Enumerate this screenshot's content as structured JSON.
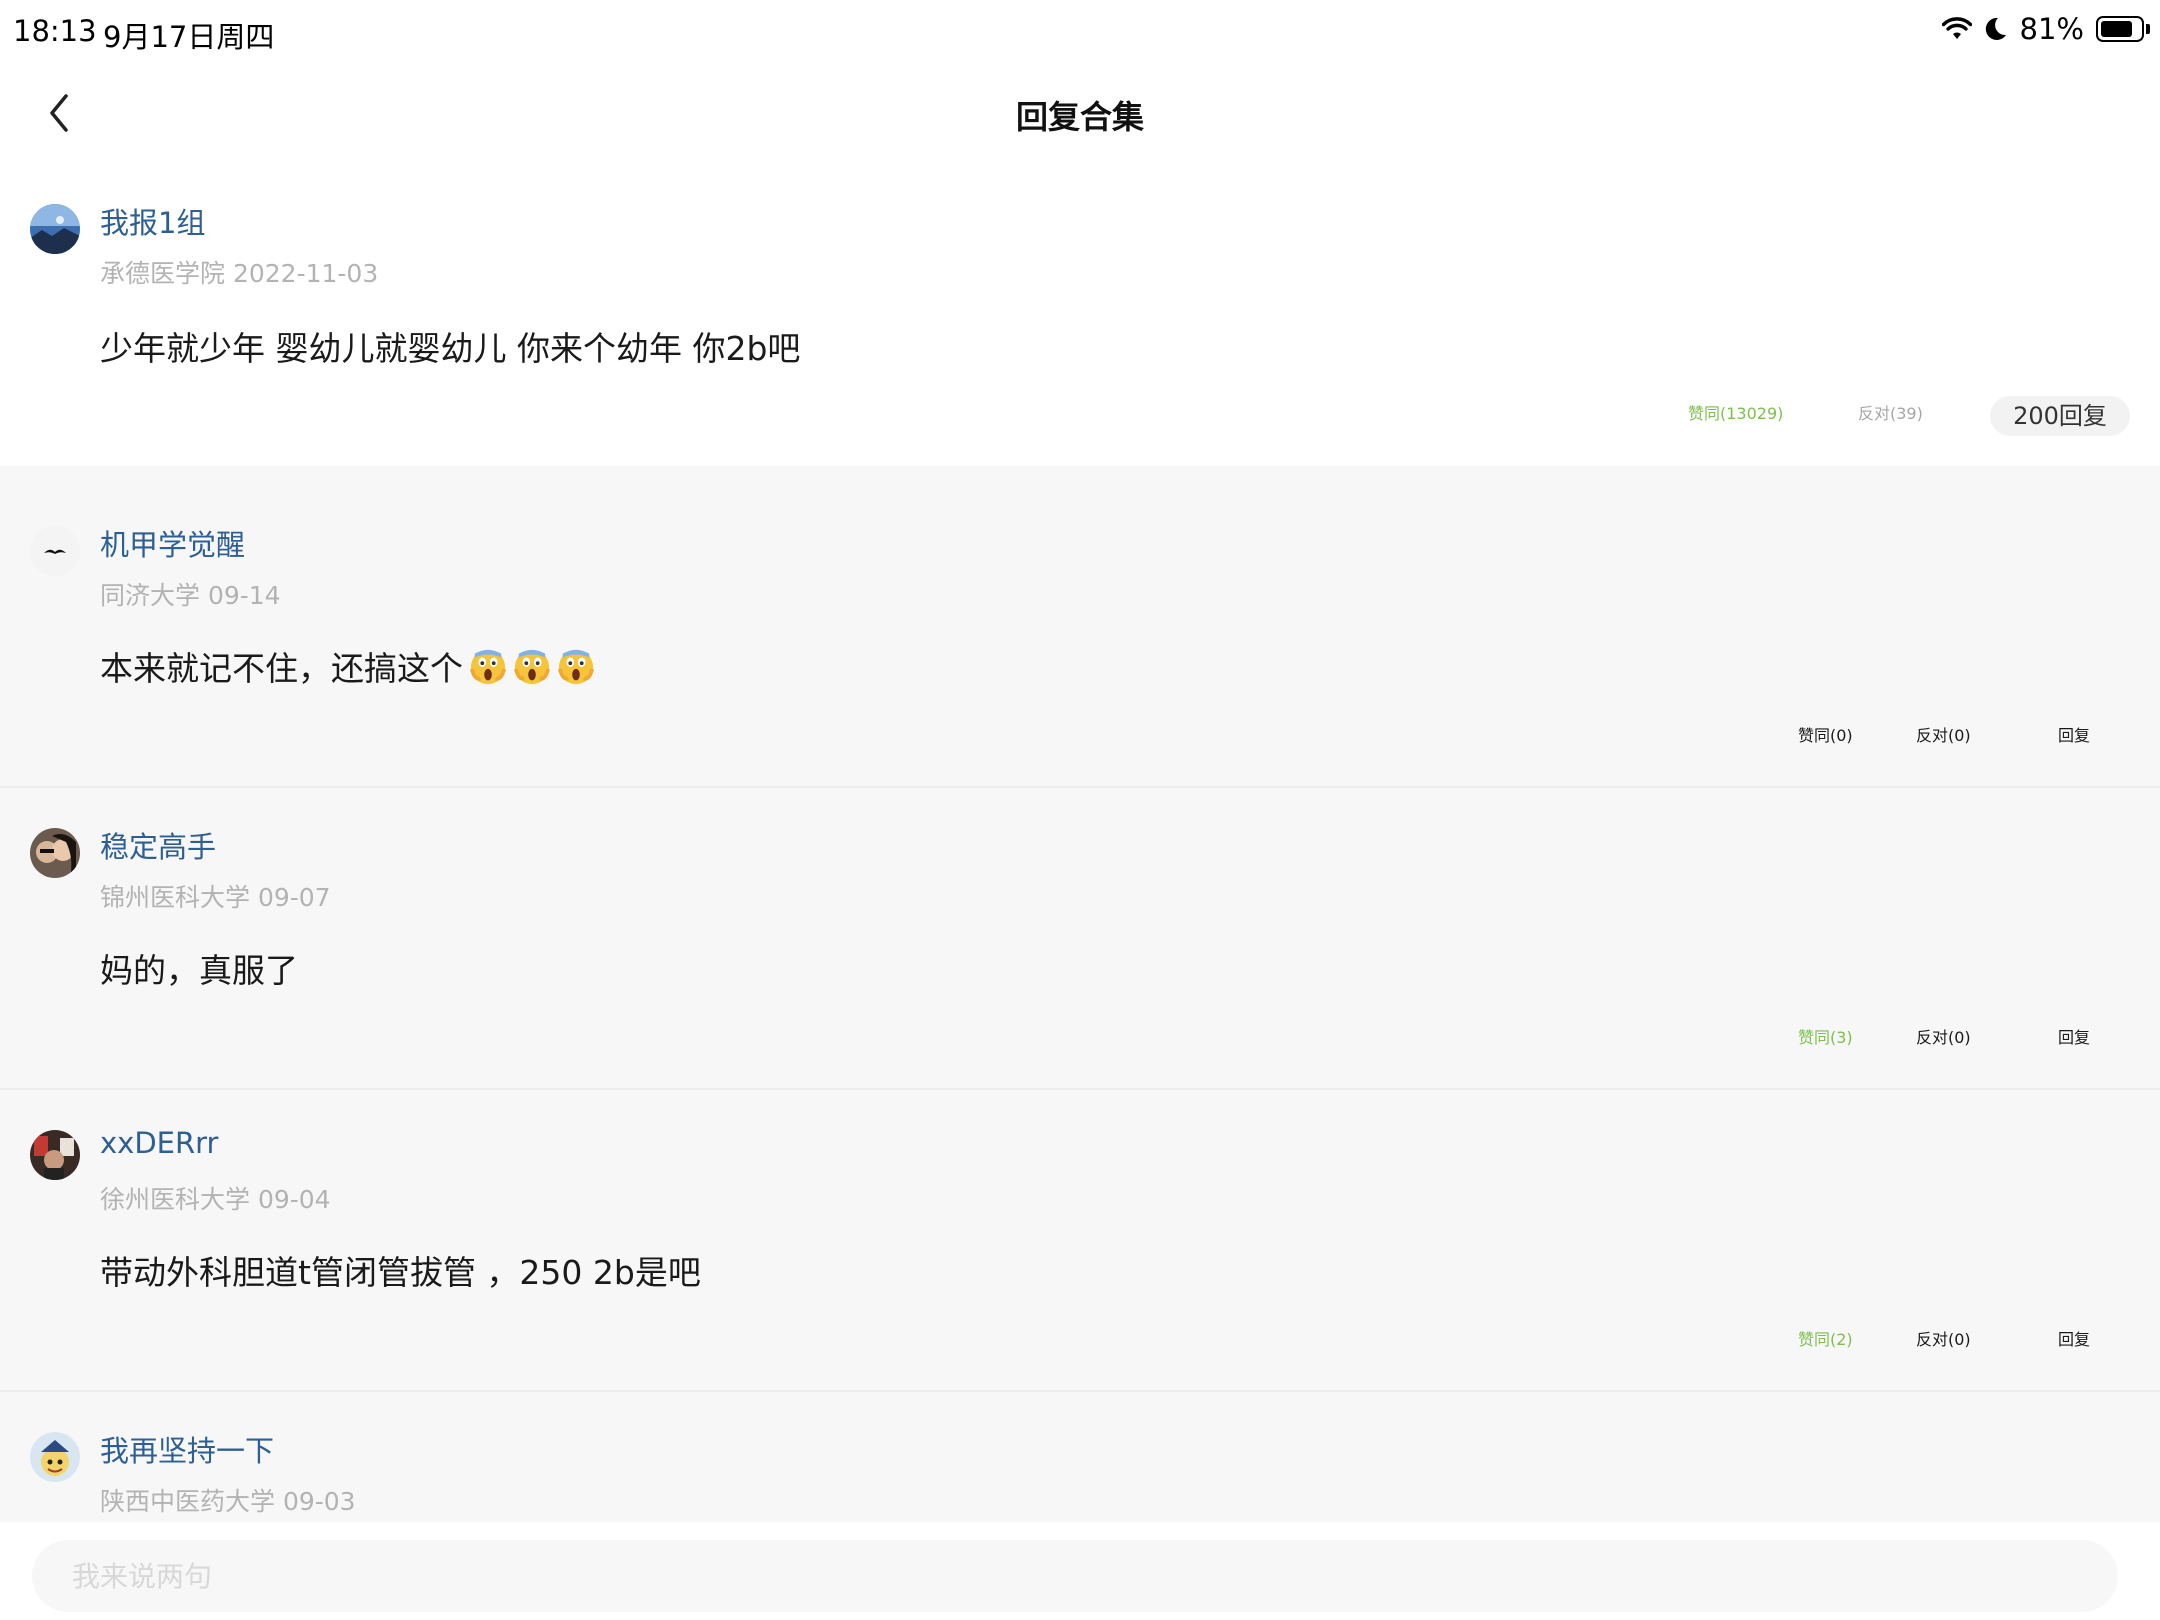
{
  "status": {
    "time": "18:13",
    "date": "9月17日周四",
    "battery": "81%",
    "battery_level": 0.81
  },
  "nav": {
    "title": "回复合集"
  },
  "main_post": {
    "username": "我报1组",
    "meta": "承德医学院 2022-11-03",
    "content": "少年就少年  婴幼儿就婴幼儿  你来个幼年  你2b吧",
    "agree": "赞同(13029)",
    "oppose": "反对(39)",
    "replies": "200回复"
  },
  "replies": [
    {
      "username": "机甲学觉醒",
      "meta": "同济大学 09-14",
      "content": "本来就记不住，还搞这个",
      "agree": "赞同(0)",
      "oppose": "反对(0)",
      "reply": "回复",
      "agree_active": false
    },
    {
      "username": "稳定高手",
      "meta": "锦州医科大学 09-07",
      "content": "妈的，真服了",
      "agree": "赞同(3)",
      "oppose": "反对(0)",
      "reply": "回复",
      "agree_active": true
    },
    {
      "username": "xxDERrr",
      "meta": "徐州医科大学 09-04",
      "content": "带动外科胆道t管闭管拔管 ，250 2b是吧",
      "agree": "赞同(2)",
      "oppose": "反对(0)",
      "reply": "回复",
      "agree_active": true
    },
    {
      "username": "我再坚持一下",
      "meta": "陕西中医药大学 09-03"
    }
  ],
  "input": {
    "placeholder": "我来说两句"
  },
  "colors": {
    "username": "#2d5f94",
    "agree_active": "#7cc04a",
    "muted": "#a6a6a6",
    "reply_bg": "#f7f7f7"
  }
}
